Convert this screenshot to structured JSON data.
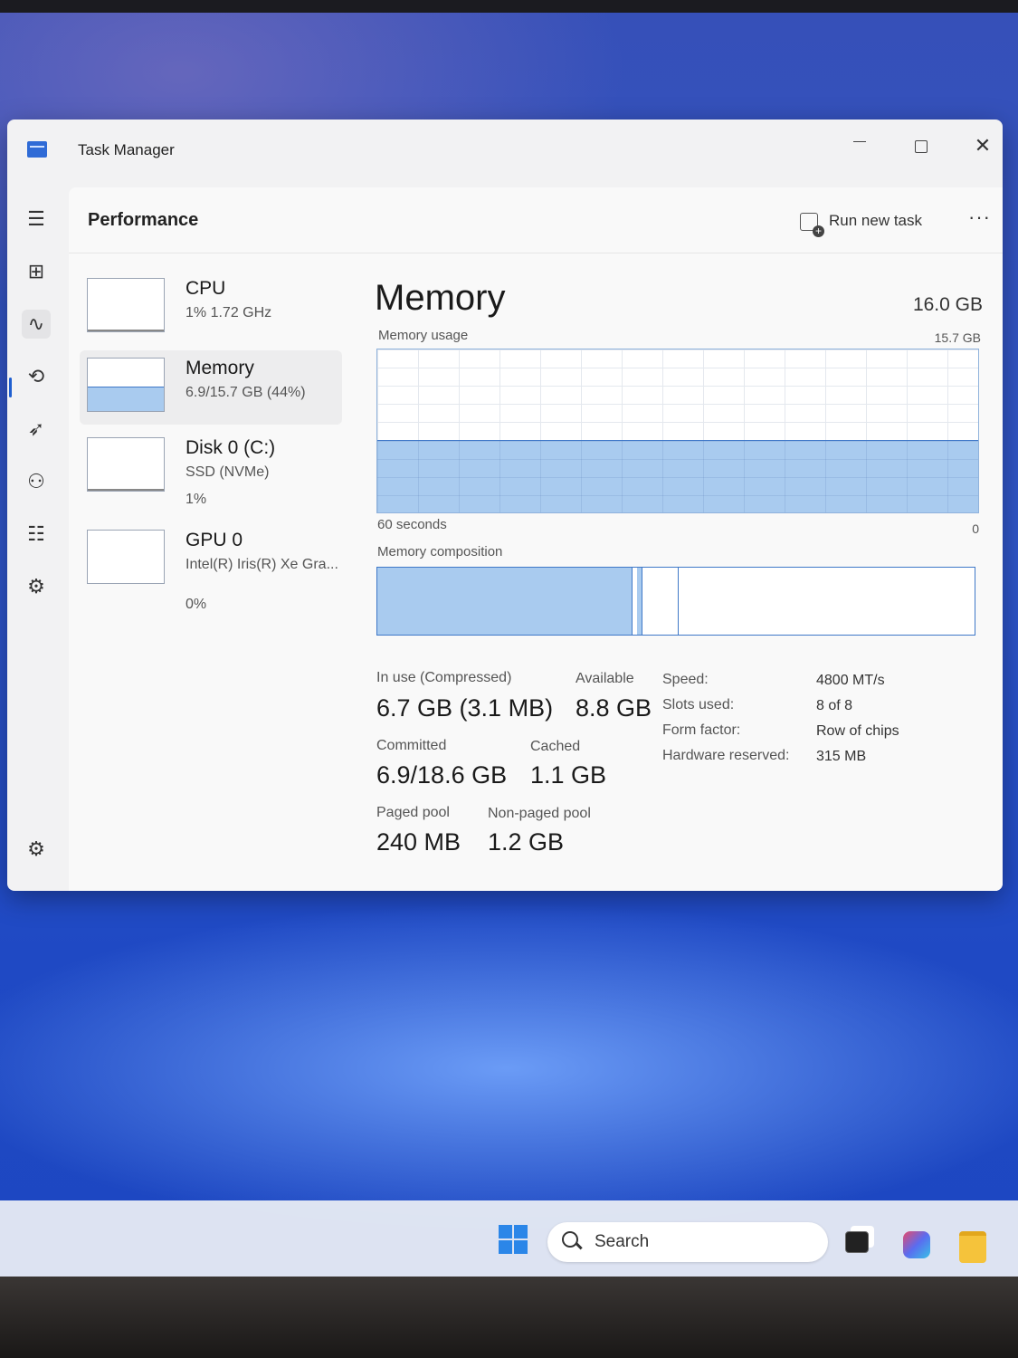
{
  "window": {
    "title": "Task Manager",
    "minimize_label": "",
    "maximize_label": "",
    "close_label": "✕"
  },
  "header": {
    "page_title": "Performance",
    "run_new_task": "Run new task",
    "more_label": "···"
  },
  "nav": {
    "menu_icon": "☰",
    "processes_icon": "⊞",
    "performance_icon": "∿",
    "history_icon": "⟲",
    "startup_icon": "➶",
    "users_icon": "⚇",
    "details_icon": "☷",
    "services_icon": "⚙",
    "settings_icon": "⚙"
  },
  "resources": [
    {
      "name": "CPU",
      "sub": "1%  1.72 GHz",
      "sub2": ""
    },
    {
      "name": "Memory",
      "sub": "6.9/15.7 GB (44%)",
      "sub2": ""
    },
    {
      "name": "Disk 0 (C:)",
      "sub": "SSD (NVMe)",
      "sub2": "1%"
    },
    {
      "name": "GPU 0",
      "sub": "Intel(R) Iris(R) Xe Gra...",
      "sub2": "0%"
    }
  ],
  "memory": {
    "title": "Memory",
    "total": "16.0 GB",
    "usage_label": "Memory usage",
    "usage_max": "15.7 GB",
    "usage_fraction": 0.44,
    "time_left": "60 seconds",
    "time_right": "0",
    "composition_label": "Memory composition",
    "stats": {
      "in_use_label": "In use (Compressed)",
      "in_use_value": "6.7 GB (3.1 MB)",
      "available_label": "Available",
      "available_value": "8.8 GB",
      "committed_label": "Committed",
      "committed_value": "6.9/18.6 GB",
      "cached_label": "Cached",
      "cached_value": "1.1 GB",
      "paged_label": "Paged pool",
      "paged_value": "240 MB",
      "nonpaged_label": "Non-paged pool",
      "nonpaged_value": "1.2 GB"
    },
    "specs": [
      {
        "label": "Speed:",
        "value": "4800 MT/s"
      },
      {
        "label": "Slots used:",
        "value": "8 of 8"
      },
      {
        "label": "Form factor:",
        "value": "Row of chips"
      },
      {
        "label": "Hardware reserved:",
        "value": "315 MB"
      }
    ]
  },
  "taskbar": {
    "search_placeholder": "Search"
  },
  "colors": {
    "accent": "#1f5fd0",
    "graph_fill": "#a9cbef",
    "graph_line": "#3f78c8"
  }
}
